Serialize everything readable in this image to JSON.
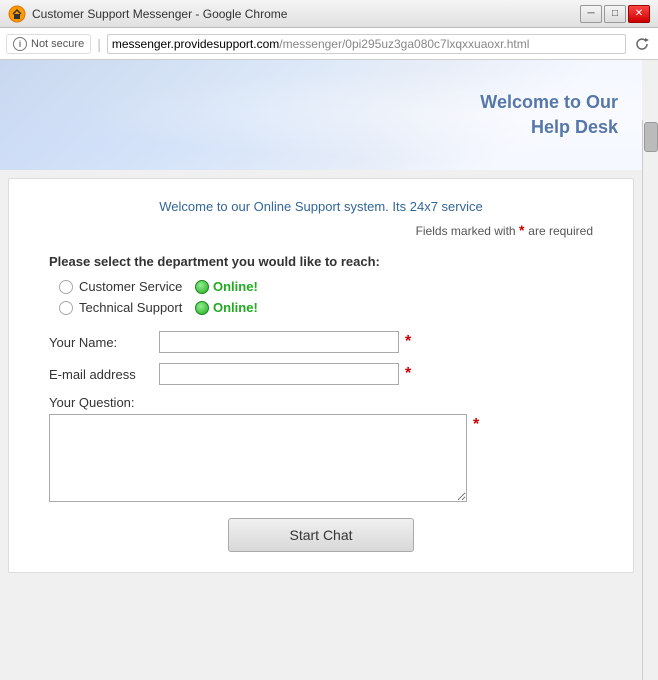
{
  "titlebar": {
    "title": "Customer Support Messenger - Google Chrome",
    "icon": "🔧",
    "buttons": {
      "minimize": "─",
      "maximize": "□",
      "close": "✕"
    }
  },
  "addressbar": {
    "security_label": "Not secure",
    "url_domain": "messenger.providesupport.com",
    "url_path": "/messenger/0pi295uz3ga080c7lxqxxuaoxr.html",
    "reload_icon": "⟳"
  },
  "banner": {
    "line1": "Welcome to Our",
    "line2": "Help Desk"
  },
  "form": {
    "welcome": "Welcome to our Online Support system. Its 24x7 service",
    "required_note": "Fields marked with",
    "required_suffix": "are required",
    "dept_label": "Please select the department you would like to reach:",
    "departments": [
      {
        "name": "Customer Service",
        "status": "Online!"
      },
      {
        "name": "Technical Support",
        "status": "Online!"
      }
    ],
    "fields": {
      "name_label": "Your Name:",
      "name_placeholder": "",
      "email_label": "E-mail address",
      "email_placeholder": "",
      "question_label": "Your Question:",
      "question_placeholder": ""
    },
    "submit_label": "Start Chat"
  }
}
